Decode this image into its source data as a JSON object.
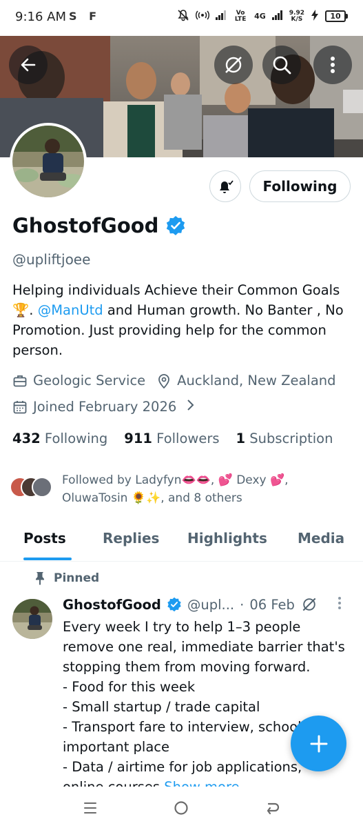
{
  "status_bar": {
    "time": "9:16 AM",
    "left_icons": "S F",
    "icons": [
      "mute-icon",
      "hotspot-icon",
      "signal-icon",
      "lte-icon",
      "signal-4g-icon",
      "charging-icon",
      "battery-icon"
    ],
    "volte_label": "Vo LTE",
    "net_label": "4G",
    "speed_value": "9.92",
    "speed_unit": "K/S",
    "battery": "10"
  },
  "header": {
    "buttons": [
      "back-arrow-icon",
      "grok-icon",
      "search-icon",
      "more-vertical-icon"
    ]
  },
  "profile": {
    "display_name": "GhostofGood",
    "verified": true,
    "handle": "@upliftjoee",
    "follow_button": "Following",
    "bio_before_link": "Helping individuals Achieve their Common Goals 🏆. ",
    "bio_link": "@ManUtd",
    "bio_after_link": " and Human growth. No Banter , No Promotion. Just providing help for the common person.",
    "category": "Geologic Service",
    "location": "Auckland, New Zealand",
    "joined": "Joined February 2026",
    "stats": {
      "following_count": "432",
      "following_label": "Following",
      "followers_count": "911",
      "followers_label": "Followers",
      "subscriptions_count": "1",
      "subscriptions_label": "Subscription"
    },
    "followed_by": "Followed by Ladyfyn👄👄, 💕 Dexy 💕, OluwaTosin 🌻✨, and 8 others"
  },
  "tabs": [
    {
      "label": "Posts",
      "active": true
    },
    {
      "label": "Replies",
      "active": false
    },
    {
      "label": "Highlights",
      "active": false
    },
    {
      "label": "Media",
      "active": false
    }
  ],
  "pinned_post": {
    "pinned_label": "Pinned",
    "author": "GhostofGood",
    "handle": "@upl...",
    "dot": "·",
    "date": "06 Feb",
    "lines": [
      "Every week I try to help 1–3 people",
      "remove one real, immediate barrier that's",
      "stopping them from moving forward.",
      "- Food for this week",
      "- Small startup / trade capital",
      "- Transport fare to interview, school or",
      "important place",
      "- Data / airtime for job applications,",
      "online courses "
    ],
    "show_more": "Show more"
  },
  "colors": {
    "accent": "#1d9bf0",
    "text_primary": "#0f1419",
    "text_secondary": "#536471",
    "border": "#cfd9de"
  },
  "fab": {
    "icon": "plus-icon"
  },
  "nav_bar": {
    "icons": [
      "recents-icon",
      "home-icon",
      "back-icon"
    ]
  }
}
